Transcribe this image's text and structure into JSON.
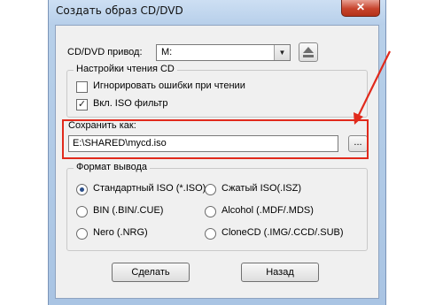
{
  "window": {
    "title": "Создать образ CD/DVD",
    "close_label": "✕"
  },
  "drive": {
    "label": "CD/DVD привод:",
    "value": "M:"
  },
  "read_settings": {
    "legend": "Настройки чтения CD",
    "ignore_errors_label": "Игнорировать ошибки при чтении",
    "ignore_errors_checked": false,
    "iso_filter_label": "Вкл. ISO фильтр",
    "iso_filter_checked": true
  },
  "save_as": {
    "label": "Сохранить как:",
    "value": "E:\\SHARED\\mycd.iso",
    "browse_label": "..."
  },
  "output_format": {
    "legend": "Формат вывода",
    "options": [
      {
        "label": "Стандартный ISO (*.ISO)",
        "selected": true
      },
      {
        "label": "Сжатый ISO(.ISZ)",
        "selected": false
      },
      {
        "label": "BIN (.BIN/.CUE)",
        "selected": false
      },
      {
        "label": "Alcohol (.MDF/.MDS)",
        "selected": false
      },
      {
        "label": "Nero (.NRG)",
        "selected": false
      },
      {
        "label": "CloneCD (.IMG/.CCD/.SUB)",
        "selected": false
      }
    ]
  },
  "buttons": {
    "make": "Сделать",
    "back": "Назад"
  },
  "annotation": {
    "color": "#e12a1c"
  }
}
